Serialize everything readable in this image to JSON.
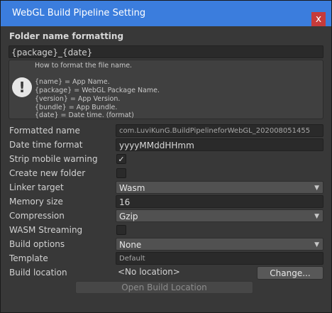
{
  "window": {
    "title": "WebGL Build Pipeline Setting",
    "close_glyph": "x"
  },
  "folder_section": {
    "header": "Folder name formatting",
    "format_value": "{package}_{date}",
    "help": {
      "icon": "warning-icon",
      "intro": "How to format the file name.",
      "lines": [
        "{name} = App Name.",
        "{package} = WebGL Package Name.",
        "{version} = App Version.",
        "{bundle} = App Bundle.",
        "{date} = Date time. (format)"
      ]
    }
  },
  "fields": {
    "formatted_name": {
      "label": "Formatted name",
      "value": "com.LuviKunG.BuildPipelineforWebGL_202008051455"
    },
    "date_time_format": {
      "label": "Date time format",
      "value": "yyyyMMddHHmm"
    },
    "strip_mobile_warning": {
      "label": "Strip mobile warning",
      "checked": true,
      "glyph": "✓"
    },
    "create_new_folder": {
      "label": "Create new folder",
      "checked": false
    },
    "linker_target": {
      "label": "Linker target",
      "value": "Wasm"
    },
    "memory_size": {
      "label": "Memory size",
      "value": "16"
    },
    "compression": {
      "label": "Compression",
      "value": "Gzip"
    },
    "wasm_streaming": {
      "label": "WASM Streaming",
      "checked": false
    },
    "build_options": {
      "label": "Build options",
      "value": "None"
    },
    "template": {
      "label": "Template",
      "value": "Default"
    },
    "build_location": {
      "label": "Build location",
      "value": "<No location>",
      "button": "Change..."
    }
  },
  "actions": {
    "open_build_location": "Open Build Location"
  },
  "colors": {
    "titlebar": "#3b7ddd",
    "close": "#c63b3b",
    "panel": "#383838"
  }
}
